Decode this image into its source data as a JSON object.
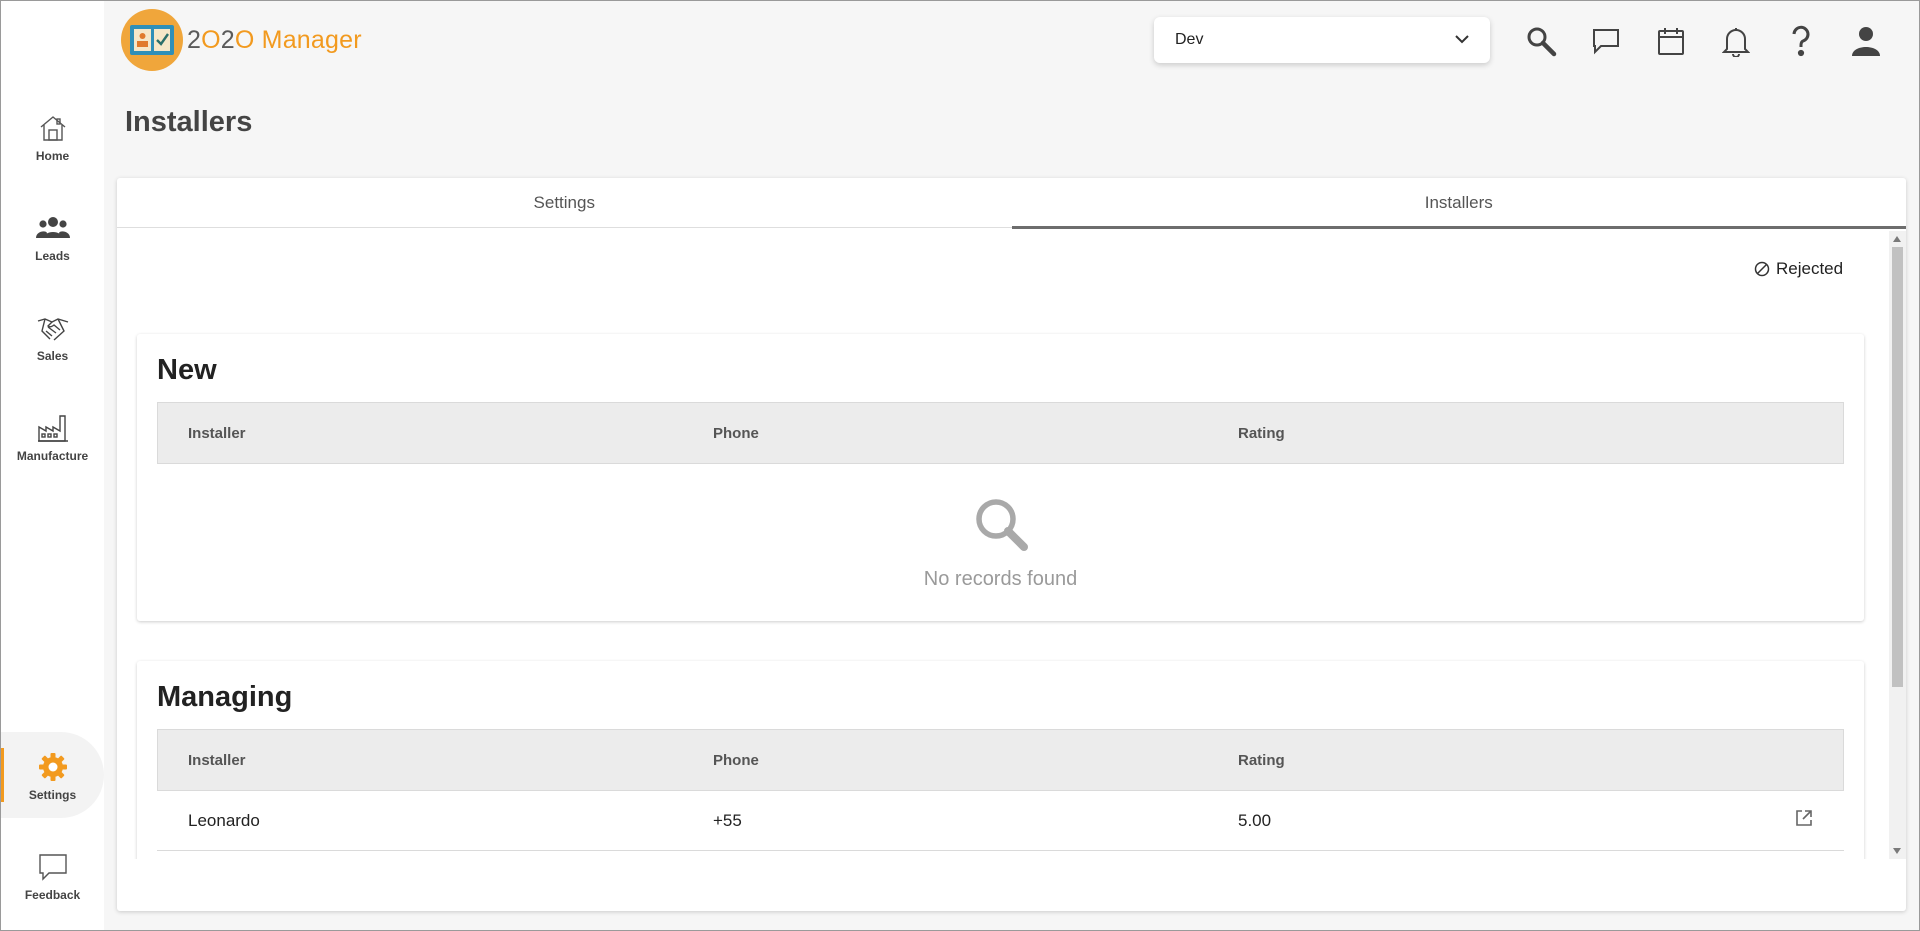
{
  "sidebar": {
    "items": [
      {
        "label": "Home",
        "icon": "home-icon"
      },
      {
        "label": "Leads",
        "icon": "people-icon"
      },
      {
        "label": "Sales",
        "icon": "handshake-icon"
      },
      {
        "label": "Manufacture",
        "icon": "factory-icon"
      },
      {
        "label": "Settings",
        "icon": "gear-icon",
        "active": true
      },
      {
        "label": "Feedback",
        "icon": "comment-icon"
      }
    ],
    "accent_color": "#f29a1f"
  },
  "header": {
    "logo_text_prefix": "2",
    "logo_text_o": "O",
    "logo_text_mid": "2",
    "logo_text_o2": "O",
    "logo_text_suffix": " Manager",
    "environment": "Dev",
    "icons": [
      "search-icon",
      "chat-icon",
      "calendar-icon",
      "bell-icon",
      "help-icon",
      "user-icon"
    ]
  },
  "page": {
    "title": "Installers"
  },
  "tabs": [
    {
      "label": "Settings",
      "active": false
    },
    {
      "label": "Installers",
      "active": true
    }
  ],
  "rejected_label": "Rejected",
  "sections": {
    "new": {
      "title": "New",
      "columns": [
        "Installer",
        "Phone",
        "Rating"
      ],
      "empty_text": "No records found"
    },
    "managing": {
      "title": "Managing",
      "columns": [
        "Installer",
        "Phone",
        "Rating"
      ],
      "rows": [
        {
          "installer": "Leonardo",
          "phone": "+55",
          "rating": "5.00"
        }
      ]
    }
  }
}
